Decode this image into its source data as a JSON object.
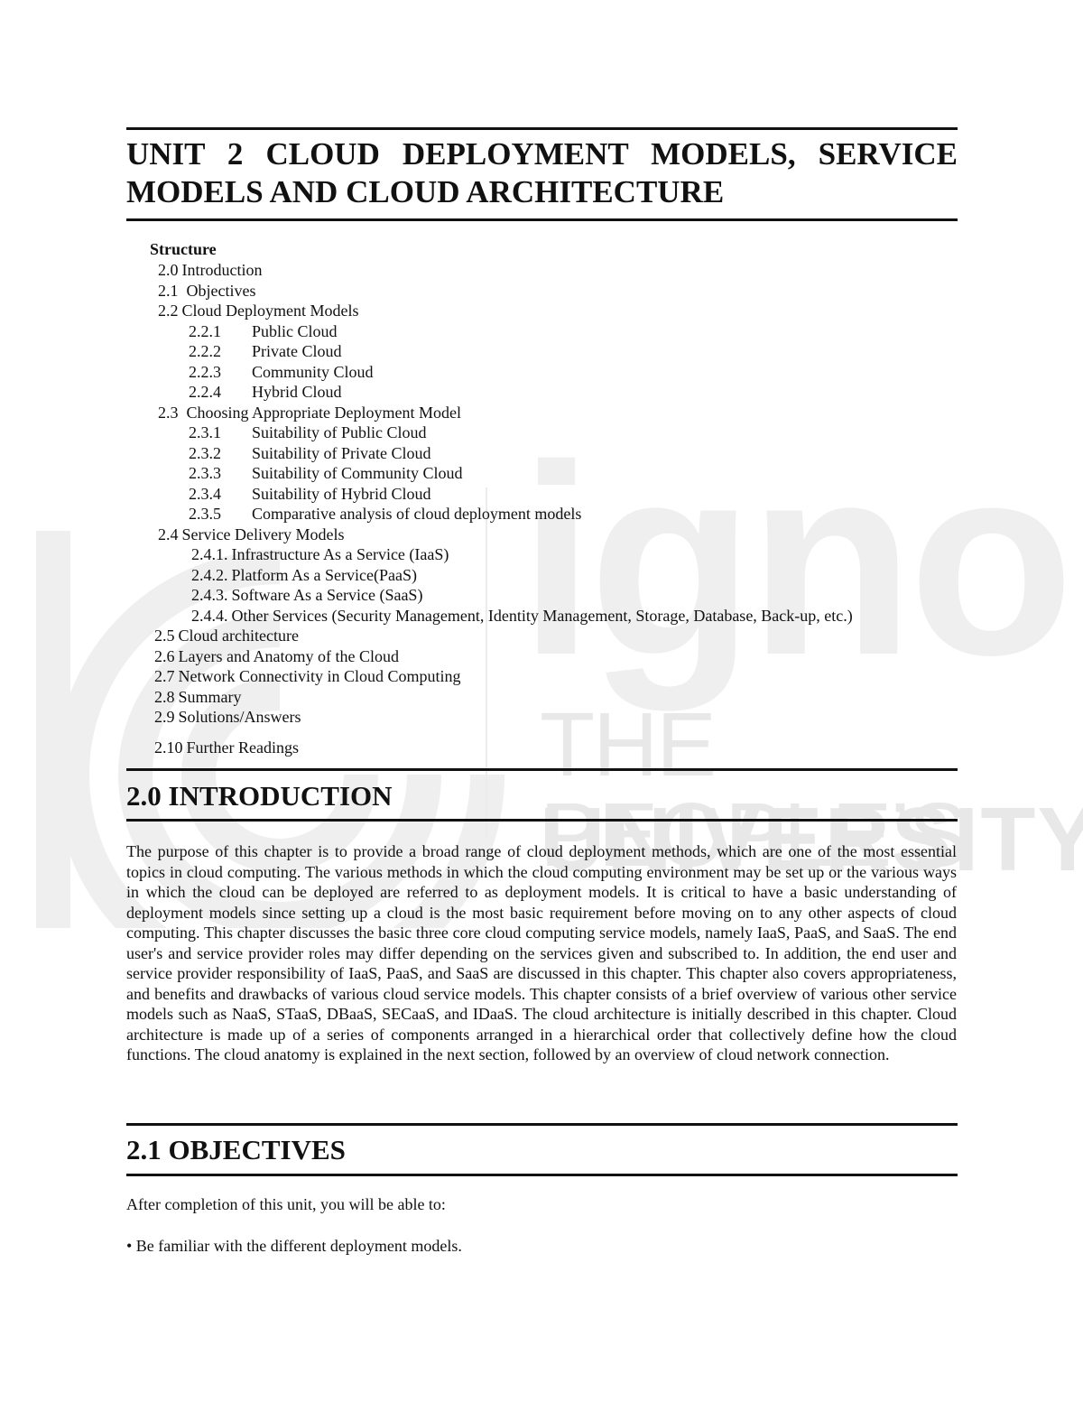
{
  "watermark": {
    "brand": "ignou",
    "tagline_line1": "THE PEOPLE’S",
    "tagline_line2": "UNIVERSITY",
    "logo_icon": "ignou-logo-icon",
    "color": "#efefef"
  },
  "unit_title": {
    "line1": "UNIT 2 CLOUD DEPLOYMENT MODELS, SERVICE",
    "line2": "MODELS AND CLOUD ARCHITECTURE"
  },
  "structure": {
    "heading": "Structure",
    "items": [
      {
        "num": "2.0",
        "label": "Introduction",
        "level": 1
      },
      {
        "num": "2.1",
        "label": "Objectives",
        "level": 1
      },
      {
        "num": "2.2",
        "label": "Cloud Deployment Models",
        "level": 1
      },
      {
        "num": "2.2.1",
        "label": "Public Cloud",
        "level": 2
      },
      {
        "num": "2.2.2",
        "label": "Private Cloud",
        "level": 2
      },
      {
        "num": "2.2.3",
        "label": "Community Cloud",
        "level": 2
      },
      {
        "num": "2.2.4",
        "label": "Hybrid Cloud",
        "level": 2
      },
      {
        "num": "2.3",
        "label": "Choosing Appropriate Deployment Model",
        "level": 1
      },
      {
        "num": "2.3.1",
        "label": "Suitability of Public Cloud",
        "level": 2
      },
      {
        "num": "2.3.2",
        "label": "Suitability of Private Cloud",
        "level": 2
      },
      {
        "num": "2.3.3",
        "label": "Suitability of Community Cloud",
        "level": 2
      },
      {
        "num": "2.3.4",
        "label": "Suitability of Hybrid Cloud",
        "level": 2
      },
      {
        "num": "2.3.5",
        "label": "Comparative analysis of cloud deployment models",
        "level": 2
      },
      {
        "num": "2.4",
        "label": "Service Delivery Models",
        "level": 1
      },
      {
        "num": "2.4.1.",
        "label": "Infrastructure As a Service (IaaS)",
        "level": 3
      },
      {
        "num": "2.4.2.",
        "label": "Platform As a Service(PaaS)",
        "level": 3
      },
      {
        "num": "2.4.3.",
        "label": "Software As a Service (SaaS)",
        "level": 3
      },
      {
        "num": "2.4.4.",
        "label": "Other Services (Security Management, Identity Management, Storage, Database, Back-up, etc.)",
        "level": 3
      },
      {
        "num": "2.5",
        "label": "Cloud architecture",
        "level": 1
      },
      {
        "num": "2.6",
        "label": "Layers and Anatomy of the Cloud",
        "level": 1
      },
      {
        "num": "2.7",
        "label": "Network Connectivity in Cloud Computing",
        "level": 1
      },
      {
        "num": "2.8",
        "label": "Summary",
        "level": 1
      },
      {
        "num": "2.9",
        "label": "Solutions/Answers",
        "level": 1
      },
      {
        "num": "2.10",
        "label": "Further Readings",
        "level": 1
      }
    ]
  },
  "introduction": {
    "heading": "2.0 INTRODUCTION",
    "paragraph": "The purpose of this chapter is to provide a broad range of cloud deployment methods, which are one of the most essential topics in cloud computing. The various methods in which the cloud computing environment may be set up or the various ways in which the cloud can be deployed are referred to as deployment models. It is critical to have a basic understanding of deployment models since setting up a cloud is the most basic requirement before moving on to any other aspects of cloud computing. This chapter discusses the basic three core cloud computing service models, namely IaaS, PaaS, and SaaS. The end user's and service provider roles may differ depending on the services given and subscribed to. In addition, the end user and service provider responsibility of IaaS, PaaS, and SaaS are discussed in this chapter. This chapter also covers appropriateness, and benefits and drawbacks of various cloud service models. This chapter consists of a brief overview of various other service models such as NaaS, STaaS, DBaaS, SECaaS, and IDaaS. The cloud architecture is initially described in this chapter. Cloud architecture is made up of a series of components arranged in a hierarchical order that collectively define how the cloud functions. The cloud anatomy is explained in the next section, followed by an overview of cloud network connection."
  },
  "objectives": {
    "heading": "2.1 OBJECTIVES",
    "lead": "After completion of this unit, you will be able to:",
    "bullets": [
      "• Be familiar with the different deployment models."
    ]
  }
}
